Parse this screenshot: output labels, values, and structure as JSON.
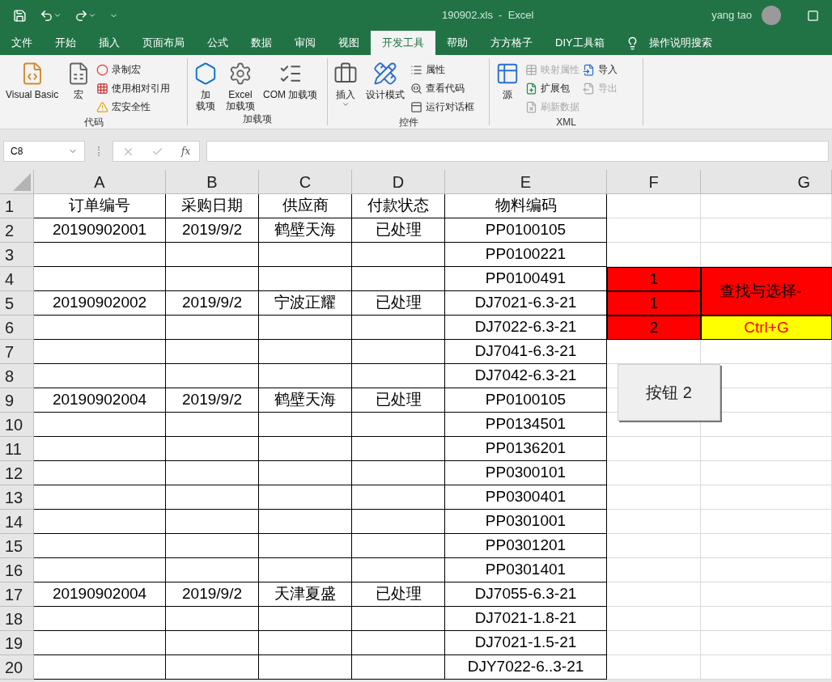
{
  "window": {
    "title": "190902.xls  -  Excel",
    "user": "yang tao"
  },
  "tabs": [
    {
      "label": "文件",
      "selected": false
    },
    {
      "label": "开始",
      "selected": false
    },
    {
      "label": "插入",
      "selected": false
    },
    {
      "label": "页面布局",
      "selected": false
    },
    {
      "label": "公式",
      "selected": false
    },
    {
      "label": "数据",
      "selected": false
    },
    {
      "label": "审阅",
      "selected": false
    },
    {
      "label": "视图",
      "selected": false
    },
    {
      "label": "开发工具",
      "selected": true
    },
    {
      "label": "帮助",
      "selected": false
    },
    {
      "label": "方方格子",
      "selected": false
    },
    {
      "label": "DIY工具箱",
      "selected": false
    }
  ],
  "tell_me": "操作说明搜索",
  "ribbon": [
    {
      "label": "代码",
      "large": [
        {
          "lines": [
            "Visual Basic"
          ],
          "dropdown": false
        },
        {
          "lines": [
            "宏"
          ],
          "dropdown": false
        }
      ],
      "small": [
        {
          "label": "录制宏",
          "disabled": false
        },
        {
          "label": "使用相对引用",
          "disabled": false
        },
        {
          "label": "宏安全性",
          "disabled": false
        }
      ]
    },
    {
      "label": "加载项",
      "large": [
        {
          "lines": [
            "加",
            "载项"
          ],
          "dropdown": false
        },
        {
          "lines": [
            "Excel",
            "加载项"
          ],
          "dropdown": false
        },
        {
          "lines": [
            "COM 加载项"
          ],
          "dropdown": false
        }
      ]
    },
    {
      "label": "控件",
      "large": [
        {
          "lines": [
            "插入"
          ],
          "dropdown": true
        },
        {
          "lines": [
            "设计模式"
          ],
          "dropdown": false
        }
      ],
      "small": [
        {
          "label": "属性",
          "disabled": false
        },
        {
          "label": "查看代码",
          "disabled": false
        },
        {
          "label": "运行对话框",
          "disabled": false
        }
      ]
    },
    {
      "label": "XML",
      "large": [
        {
          "lines": [
            "源"
          ],
          "dropdown": false
        }
      ],
      "small": [
        {
          "label": "映射属性",
          "disabled": true
        },
        {
          "label": "扩展包",
          "disabled": false
        },
        {
          "label": "刷新数据",
          "disabled": true
        },
        {
          "label": "导入",
          "disabled": false
        },
        {
          "label": "导出",
          "disabled": true
        }
      ]
    }
  ],
  "name_box": "C8",
  "function_button": "fx",
  "columns": [
    "A",
    "B",
    "C",
    "D",
    "E",
    "F",
    "G"
  ],
  "rows": [
    {
      "number": "1",
      "cells": {
        "A": "订单编号",
        "B": "采购日期",
        "C": "供应商",
        "D": "付款状态",
        "E": "物料编码"
      }
    },
    {
      "number": "2",
      "cells": {
        "A": "20190902001",
        "B": "2019/9/2",
        "C": "鹤壁天海",
        "D": "已处理",
        "E": "PP0100105"
      }
    },
    {
      "number": "3",
      "cells": {
        "E": "PP0100221"
      }
    },
    {
      "number": "4",
      "cells": {
        "E": "PP0100491",
        "F": {
          "text": "1",
          "color": "#ff0000"
        },
        "G": {
          "text": "查找与选择-",
          "color": "#ff0000",
          "merged": true
        }
      }
    },
    {
      "number": "5",
      "cells": {
        "A": "20190902002",
        "B": "2019/9/2",
        "C": "宁波正耀",
        "D": "已处理",
        "E": "DJ7021-6.3-21",
        "F": {
          "text": "1",
          "color": "#ff0000"
        }
      }
    },
    {
      "number": "6",
      "cells": {
        "E": "DJ7022-6.3-21",
        "F": {
          "text": "2",
          "color": "#ff0000"
        },
        "G": {
          "text": "Ctrl+G",
          "color": "#ffff00",
          "kind": "shortcut"
        }
      }
    },
    {
      "number": "7",
      "cells": {
        "E": "DJ7041-6.3-21"
      }
    },
    {
      "number": "8",
      "cells": {
        "E": "DJ7042-6.3-21"
      }
    },
    {
      "number": "9",
      "cells": {
        "A": "20190902004",
        "B": "2019/9/2",
        "C": "鹤壁天海",
        "D": "已处理",
        "E": "PP0100105"
      }
    },
    {
      "number": "10",
      "cells": {
        "E": "PP0134501"
      }
    },
    {
      "number": "11",
      "cells": {
        "E": "PP0136201"
      }
    },
    {
      "number": "12",
      "cells": {
        "E": "PP0300101"
      }
    },
    {
      "number": "13",
      "cells": {
        "E": "PP0300401"
      }
    },
    {
      "number": "14",
      "cells": {
        "E": "PP0301001"
      }
    },
    {
      "number": "15",
      "cells": {
        "E": "PP0301201"
      }
    },
    {
      "number": "16",
      "cells": {
        "E": "PP0301401"
      }
    },
    {
      "number": "17",
      "cells": {
        "A": "20190902004",
        "B": "2019/9/2",
        "C": "天津夏盛",
        "D": "已处理",
        "E": "DJ7055-6.3-21"
      }
    },
    {
      "number": "18",
      "cells": {
        "E": "DJ7021-1.8-21"
      }
    },
    {
      "number": "19",
      "cells": {
        "E": "DJ7021-1.5-21"
      }
    },
    {
      "number": "20",
      "cells": {
        "E": "DJY7022-6..3-21"
      }
    }
  ],
  "sheet_button": "按钮 2"
}
